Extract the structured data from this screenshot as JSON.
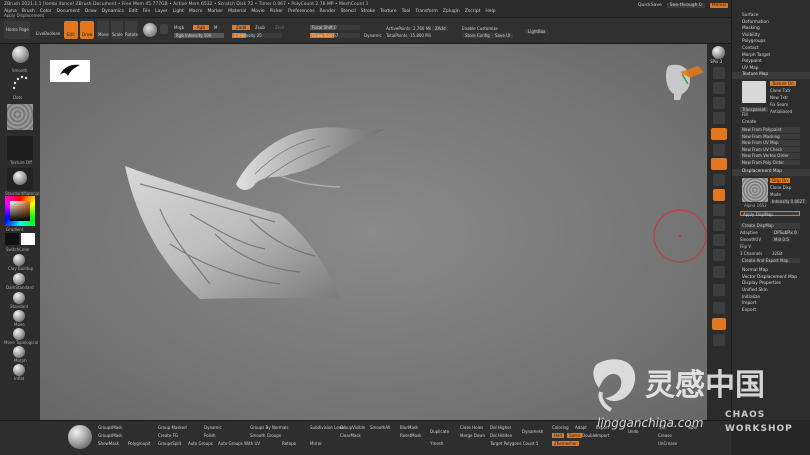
{
  "titlebar": {
    "title": "ZBrush 2021.1.1 [lombi dance]   ZBrush Document   • Free Mem 45.777GB • Active Mem 6532 • Scratch Disk 72 • Timer 0.067 • PolyCount 2.76 MP • MeshCount 1",
    "menus": [
      "Alpha",
      "Brush",
      "Color",
      "Document",
      "Draw",
      "Dynamics",
      "Edit",
      "File",
      "Layer",
      "Light",
      "Macro",
      "Marker",
      "Material",
      "Movie",
      "Picker",
      "Preferences",
      "Render",
      "Stencil",
      "Stroke",
      "Texture",
      "Tool",
      "Transform",
      "Zplugin",
      "Zscript",
      "Help"
    ],
    "right": {
      "quicksave": "QuickSave",
      "seethrough": "See-through 0",
      "menus_btn": "Menus",
      "defaultzscript": "DefaultZScript"
    },
    "apply_displacement": "Apply Displacement"
  },
  "toolbar": {
    "home_page": "Home Page",
    "lightbox": "LiveBoolean",
    "modes": [
      "Edit",
      "Draw",
      "Move",
      "Scale",
      "Rotate"
    ],
    "mrgb": "Mrgb",
    "rgb": "Rgb",
    "m": "M",
    "zadd": "Zadd",
    "zsub": "Zsub",
    "zcut": "Zcut",
    "rgb_intensity": "Rgb Intensity 100",
    "z_intensity": "Z Intensity 25",
    "focal_shift": "Focal Shift 0",
    "draw_size": "Draw Size 67",
    "dynamic": "Dynamic",
    "active_points": "ActivePoints: 2,760 Mil",
    "total_points": "TotalPoints: 15.800 Mil",
    "zadd2": "ZAdd",
    "enable_customize": "Enable Customize",
    "store_config": "Store Config",
    "save_ui": "Save UI",
    "lightbox2": "LightBox"
  },
  "left_shelf": {
    "items": [
      "Smooth",
      "Dots",
      "Texture Off",
      "StandardMaterial",
      "Gradient",
      "SwitchColor",
      "Clay Buildup",
      "DamStandard",
      "Standard",
      "Move",
      "Move Topological",
      "Morph",
      "Inflat"
    ]
  },
  "palette": {
    "top_items": [
      "Surface",
      "Deformation",
      "Masking",
      "Visibility",
      "Polygroups",
      "Contact",
      "Morph Target",
      "Polypaint",
      "UV Map",
      "Texture Map"
    ],
    "texture_map": {
      "texture_on": "Texture On",
      "clone_txtr": "Clone Txtr",
      "new_txtr": "New Txtr",
      "fix_seam": "Fix Seam",
      "transparent": "Transparent",
      "antialiased": "Antialiased",
      "fill": "Fill",
      "create": "Create",
      "buttons": [
        "New From Polypaint",
        "New From Masking",
        "New From UV Map",
        "New From UV Check",
        "New From Vertex Order",
        "New From Poly Order"
      ]
    },
    "displacement": {
      "header": "Displacement Map",
      "disp_on": "Disp On",
      "clone_disp": "Clone Disp",
      "mode": "Mode",
      "intensity": "Intensity 0.0627",
      "apply": "Apply DispMap",
      "create": "Create DispMap",
      "adaptive": "Adaptive",
      "dpsubpix": "DPSubPix 0",
      "smooth_uv": "SmoothUV",
      "mid": "Mid 0.5",
      "flip_v": "Flip V",
      "channels": "3 Channels",
      "size": "32Bit",
      "create_export": "Create And Export Map",
      "thumb": "Alpha 1652"
    },
    "lower_items": [
      "Normal Map",
      "Vector Displacement Map",
      "Display Properties",
      "Unified Skin",
      "Initialize",
      "Import",
      "Export"
    ]
  },
  "right_shelf": [
    "SPix 3",
    "Scroll",
    "Zoom",
    "Actual",
    "AAHalf",
    "Persp",
    "Floor",
    "Local",
    "L.Sym",
    "Gxyz",
    "Frame",
    "Move",
    "Scale",
    "Rotate",
    "Line Fill",
    "PolyF",
    "Transp",
    "Ghost",
    "Solo",
    "Xpose"
  ],
  "bottom": {
    "labels": [
      "GroupsMask",
      "GroupsMask",
      "Group Masked",
      "Dynamic",
      "Groups By Normals",
      "Smooth Groups",
      "ShowMask",
      "Polygroupit",
      "Create FG",
      "GroupsSplit",
      "Polish",
      "Auto Groups",
      "Auto Groups With UV",
      "Retopo",
      "Mirror",
      "GroupVisible",
      "ClearMask",
      "SmoothAll",
      "BlurMask",
      "ResetMask",
      "Duplicate",
      "Close Holes",
      "Del Hidden",
      "Del Higher",
      "Dynamesh",
      "Merge Down",
      "Coloring",
      "Target Polygons Count 5",
      "Export",
      "Import",
      "Undo",
      "ZRemesher",
      "Half",
      "Same",
      "Double",
      "Adapt",
      "Crease",
      "UnCrease",
      "Subdivision Level",
      "Ymesh"
    ],
    "fill_label": "Fill",
    "fill_value": "SDiv"
  },
  "watermark": {
    "chinese": "灵感中国",
    "url": "lingganchina.com",
    "brand": "CHAOS",
    "brand2": "WORKSHOP"
  },
  "colors": {
    "accent": "#e2771e",
    "canvas": "#787878",
    "panel": "#2d2d2d"
  }
}
